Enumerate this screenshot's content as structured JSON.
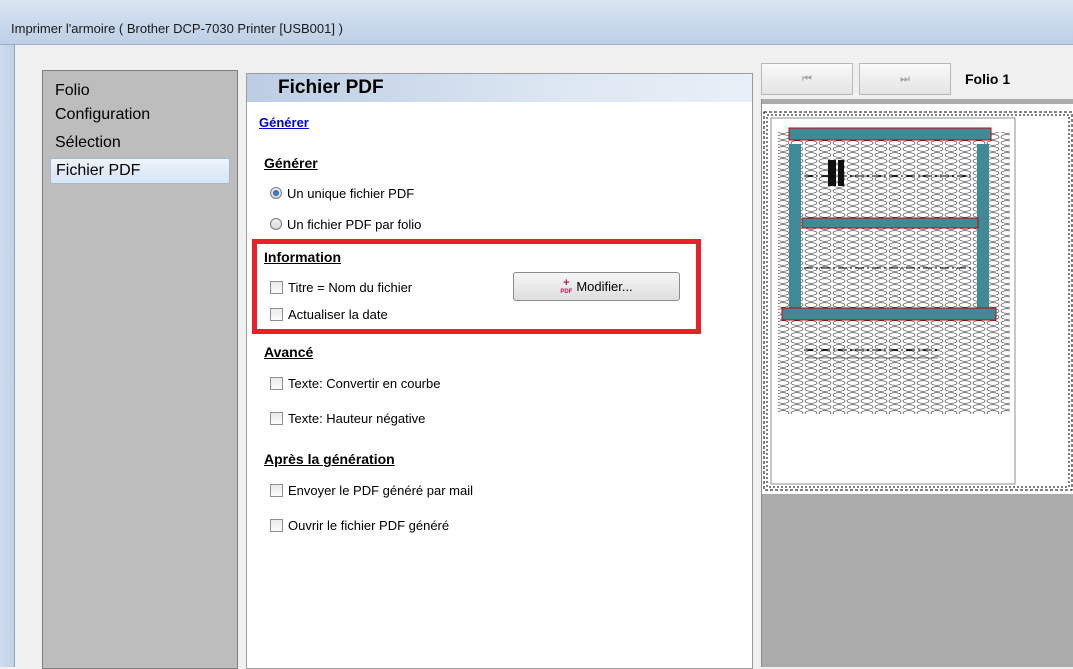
{
  "window": {
    "title": "Imprimer l'armoire ( Brother DCP-7030 Printer [USB001] )"
  },
  "nav": {
    "items": [
      {
        "label": "Folio",
        "selected": false
      },
      {
        "label": "Configuration",
        "selected": false
      },
      {
        "label": "Sélection",
        "selected": false
      },
      {
        "label": "Fichier PDF",
        "selected": true
      }
    ]
  },
  "panel": {
    "header": "Fichier PDF",
    "link": "Générer",
    "generate": {
      "title": "Générer",
      "options": [
        {
          "label": "Un unique fichier PDF",
          "checked": true
        },
        {
          "label": "Un fichier PDF par folio",
          "checked": false
        }
      ]
    },
    "information": {
      "title": "Information",
      "title_is_filename": "Titre = Nom du fichier",
      "update_date": "Actualiser la date",
      "modify_button": "Modifier...",
      "pdf_icon_text": "PDF"
    },
    "advanced": {
      "title": "Avancé",
      "convert_curve": "Texte: Convertir en courbe",
      "negative_height": "Texte: Hauteur négative"
    },
    "after": {
      "title": "Après la génération",
      "send_mail": "Envoyer le PDF généré par mail",
      "open_pdf": "Ouvrir le fichier PDF généré"
    }
  },
  "preview": {
    "first_glyph": "⏮",
    "last_glyph": "⏭",
    "folio_label": "Folio 1"
  },
  "colors": {
    "highlight_box": "#e8202a",
    "rail": "#3f8a96",
    "link": "#0000cc"
  }
}
